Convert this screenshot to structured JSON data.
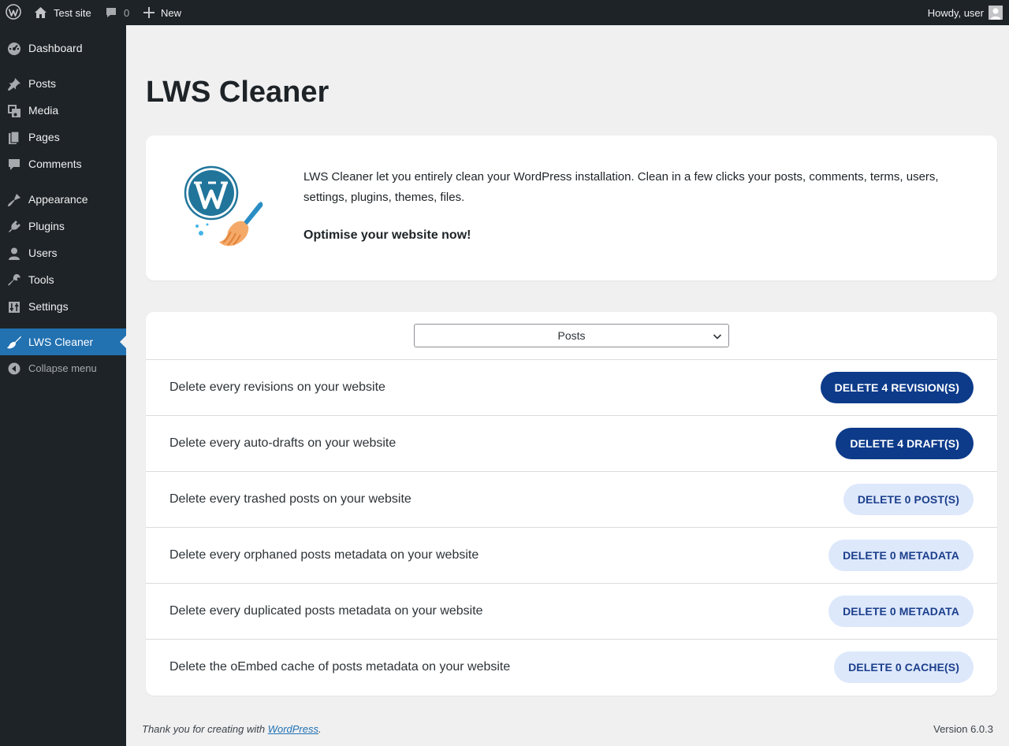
{
  "adminbar": {
    "site_name": "Test site",
    "comments_count": "0",
    "new_label": "New",
    "howdy": "Howdy, user"
  },
  "sidebar": {
    "items": [
      {
        "label": "Dashboard",
        "icon": "dashboard-icon"
      },
      {
        "label": "Posts",
        "icon": "pin-icon"
      },
      {
        "label": "Media",
        "icon": "media-icon"
      },
      {
        "label": "Pages",
        "icon": "pages-icon"
      },
      {
        "label": "Comments",
        "icon": "comment-icon"
      },
      {
        "label": "Appearance",
        "icon": "brush-icon"
      },
      {
        "label": "Plugins",
        "icon": "plug-icon"
      },
      {
        "label": "Users",
        "icon": "user-icon"
      },
      {
        "label": "Tools",
        "icon": "wrench-icon"
      },
      {
        "label": "Settings",
        "icon": "sliders-icon"
      },
      {
        "label": "LWS Cleaner",
        "icon": "broom-icon",
        "active": true
      }
    ],
    "collapse_label": "Collapse menu"
  },
  "page": {
    "title": "LWS Cleaner",
    "intro_text": "LWS Cleaner let you entirely clean your WordPress installation. Clean in a few clicks your posts, comments, terms, users, settings, plugins, themes, files.",
    "intro_strong": "Optimise your website now!"
  },
  "cleaner": {
    "selected_type": "Posts",
    "rows": [
      {
        "label": "Delete every revisions on your website",
        "button": "DELETE 4 REVISION(S)",
        "style": "dark"
      },
      {
        "label": "Delete every auto-drafts on your website",
        "button": "DELETE 4 DRAFT(S)",
        "style": "dark"
      },
      {
        "label": "Delete every trashed posts on your website",
        "button": "DELETE 0 POST(S)",
        "style": "light"
      },
      {
        "label": "Delete every orphaned posts metadata on your website",
        "button": "DELETE 0 METADATA",
        "style": "light"
      },
      {
        "label": "Delete every duplicated posts metadata on your website",
        "button": "DELETE 0 METADATA",
        "style": "light"
      },
      {
        "label": "Delete the oEmbed cache of posts metadata on your website",
        "button": "DELETE 0 CACHE(S)",
        "style": "light"
      }
    ]
  },
  "footer": {
    "thanks_prefix": "Thank you for creating with ",
    "thanks_link": "WordPress",
    "thanks_suffix": ".",
    "version": "Version 6.0.3"
  },
  "colors": {
    "admin_dark": "#1d2327",
    "accent": "#2271b1",
    "button_dark": "#0d3b8a",
    "button_light": "#dde8fb"
  }
}
